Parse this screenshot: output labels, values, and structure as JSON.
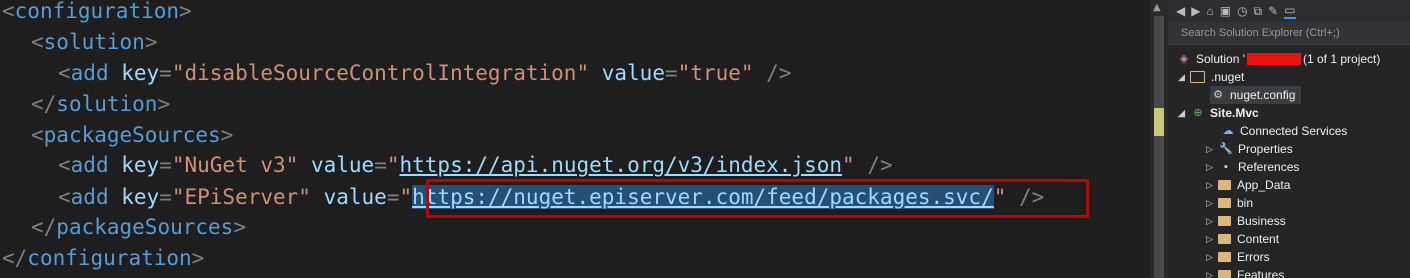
{
  "editor": {
    "lines": {
      "l1": {
        "open": "<",
        "tag": "configuration",
        "close": ">"
      },
      "l2": {
        "open": "<",
        "tag": "solution",
        "close": ">"
      },
      "l3": {
        "lt": "<",
        "tag": "add",
        "key_attr": "key",
        "eq": "=",
        "key_val": "disableSourceControlIntegration",
        "value_attr": "value",
        "value_val": "true",
        "end": " />"
      },
      "l4": {
        "open": "</",
        "tag": "solution",
        "close": ">"
      },
      "l5": {
        "open": "<",
        "tag": "packageSources",
        "close": ">"
      },
      "l6": {
        "lt": "<",
        "tag": "add",
        "key_attr": "key",
        "eq": "=",
        "key_val": "NuGet v3",
        "value_attr": "value",
        "value_val": "https://api.nuget.org/v3/index.json",
        "end": " />"
      },
      "l7": {
        "lt": "<",
        "tag": "add",
        "key_attr": "key",
        "eq": "=",
        "key_val": "EPiServer",
        "value_attr": "value",
        "value_val": "https://nuget.episerver.com/feed/packages.svc/",
        "end": " />"
      },
      "l8": {
        "open": "</",
        "tag": "packageSources",
        "close": ">"
      },
      "l9": {
        "open": "</",
        "tag": "configuration",
        "close": ">"
      }
    },
    "quote": "\"",
    "highlight_color": "#c40000"
  },
  "solution_explorer": {
    "search_placeholder": "Search Solution Explorer (Ctrl+;)",
    "toolbar_icons": [
      "back-icon",
      "forward-icon",
      "home-icon",
      "switch-views-icon",
      "history-icon",
      "collapse-all-icon",
      "properties-icon",
      "preview-icon"
    ],
    "tree": {
      "solution_prefix": "Solution '",
      "solution_suffix": "(1 of 1 project)",
      "nuget_folder": ".nuget",
      "nuget_config": "nuget.config",
      "project": "Site.Mvc",
      "items": [
        "Connected Services",
        "Properties",
        "References",
        "App_Data",
        "bin",
        "Business",
        "Content",
        "Errors",
        "Features"
      ]
    }
  },
  "colors": {
    "tag": "#569cd6",
    "attribute": "#9cdcfe",
    "string": "#ce9178",
    "punct": "#808080"
  }
}
